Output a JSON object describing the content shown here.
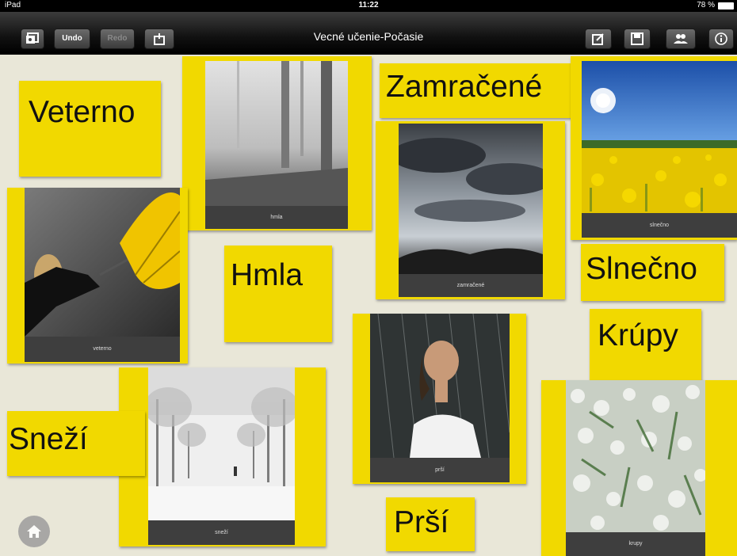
{
  "status_bar": {
    "device": "iPad",
    "time": "11:22",
    "battery": "78 %"
  },
  "toolbar": {
    "title": "Vecné učenie-Počasie",
    "undo_label": "Undo",
    "redo_label": "Redo",
    "left_icons": [
      "gallery-icon",
      "share-icon"
    ],
    "right_icons": [
      "edit-icon",
      "save-icon",
      "users-icon",
      "info-icon"
    ]
  },
  "word_cards": [
    {
      "text": "Veterno"
    },
    {
      "text": "Hmla"
    },
    {
      "text": "Zamračené"
    },
    {
      "text": "Slnečno"
    },
    {
      "text": "Krúpy"
    },
    {
      "text": "Sneží"
    },
    {
      "text": "Prší"
    }
  ],
  "picture_cards": [
    {
      "caption": "hmla",
      "image": "foggy forest"
    },
    {
      "caption": "veterno",
      "image": "woman with yellow umbrella in wind"
    },
    {
      "caption": "zamračené",
      "image": "dark clouds over hills"
    },
    {
      "caption": "slnečno",
      "image": "sun over dandelion meadow"
    },
    {
      "caption": "prší",
      "image": "woman in rain"
    },
    {
      "caption": "sneží",
      "image": "snowy alley"
    },
    {
      "caption": "krupy",
      "image": "hail on grass"
    }
  ],
  "colors": {
    "card_yellow": "#f1d900",
    "background": "#e9e7d8",
    "caption_bar": "#3e3e3e"
  },
  "home_button_icon": "home-icon"
}
